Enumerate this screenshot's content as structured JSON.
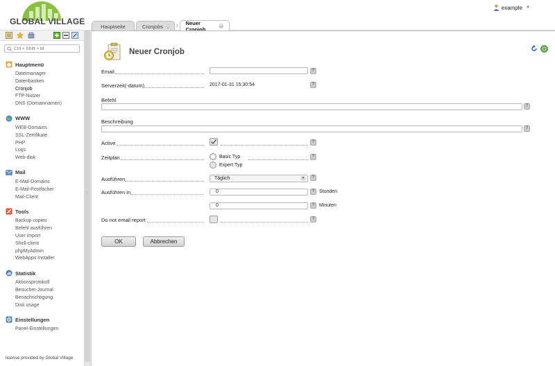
{
  "header": {
    "logo_text": "GLOBAL VILLAGE",
    "user_name": "example"
  },
  "tabs": [
    {
      "label": "Hauptseite"
    },
    {
      "label": "Cronjobs"
    },
    {
      "label": "Neuer Cronjob"
    }
  ],
  "sidebar": {
    "search_placeholder": "Ctrl + Shift + M",
    "groups": [
      {
        "title": "Hauptmenü",
        "icon": "home-icon",
        "items": [
          "Dateimanager",
          "Datenbanken",
          "Cronjob",
          "FTP-Nutzer",
          "DNS (Domainnamen)"
        ]
      },
      {
        "title": "WWW",
        "icon": "globe-icon",
        "items": [
          "WEB-Domains",
          "SSL-Zertifikate",
          "PHP",
          "Logs",
          "Web-disk"
        ]
      },
      {
        "title": "Mail",
        "icon": "mail-icon",
        "items": [
          "E-Mail-Domains",
          "E-Mail-Postfächer",
          "Mail-Client"
        ]
      },
      {
        "title": "Tools",
        "icon": "tools-icon",
        "items": [
          "Backup copies",
          "Befehl ausführen",
          "User import",
          "Shell-client",
          "phpMyAdmin",
          "WebApps Installer"
        ]
      },
      {
        "title": "Statistik",
        "icon": "stats-icon",
        "items": [
          "Aktionsprotokoll",
          "Besucher-Journal",
          "Benachrichtigung",
          "Disk usage"
        ]
      },
      {
        "title": "Einstellungen",
        "icon": "settings-icon",
        "items": [
          "Panel-Einstellungen"
        ]
      }
    ],
    "license": "license provided by Global Village"
  },
  "form": {
    "title": "Neuer Cronjob",
    "email_label": "Email",
    "email_value": "",
    "servertime_label": "Serverzeit(-datum)",
    "servertime_value": "2017-01-31 15:30:54",
    "befehl_label": "Befehl",
    "befehl_value": "",
    "beschreibung_label": "Beschreibung",
    "beschreibung_value": "",
    "active_label": "Active",
    "active_checked": true,
    "zeitplan_label": "Zeitplan",
    "zeitplan_options": [
      "Basic Typ",
      "Expert Typ"
    ],
    "zeitplan_selected": "Basic Typ",
    "ausfuehren_label": "Ausführen",
    "ausfuehren_value": "Täglich",
    "ausfuehren_in_label": "Ausführen in",
    "stunden_value": "0",
    "stunden_unit": "Stunden",
    "minuten_value": "0",
    "minuten_unit": "Minuten",
    "no_email_label": "Do not email report",
    "no_email_checked": false,
    "help": "?",
    "ok_label": "OK",
    "cancel_label": "Abbrechen"
  },
  "colors": {
    "logo_green": "#8bbf3e",
    "active_tab_bg": "#ffffff",
    "content_bg": "#ffffff"
  }
}
